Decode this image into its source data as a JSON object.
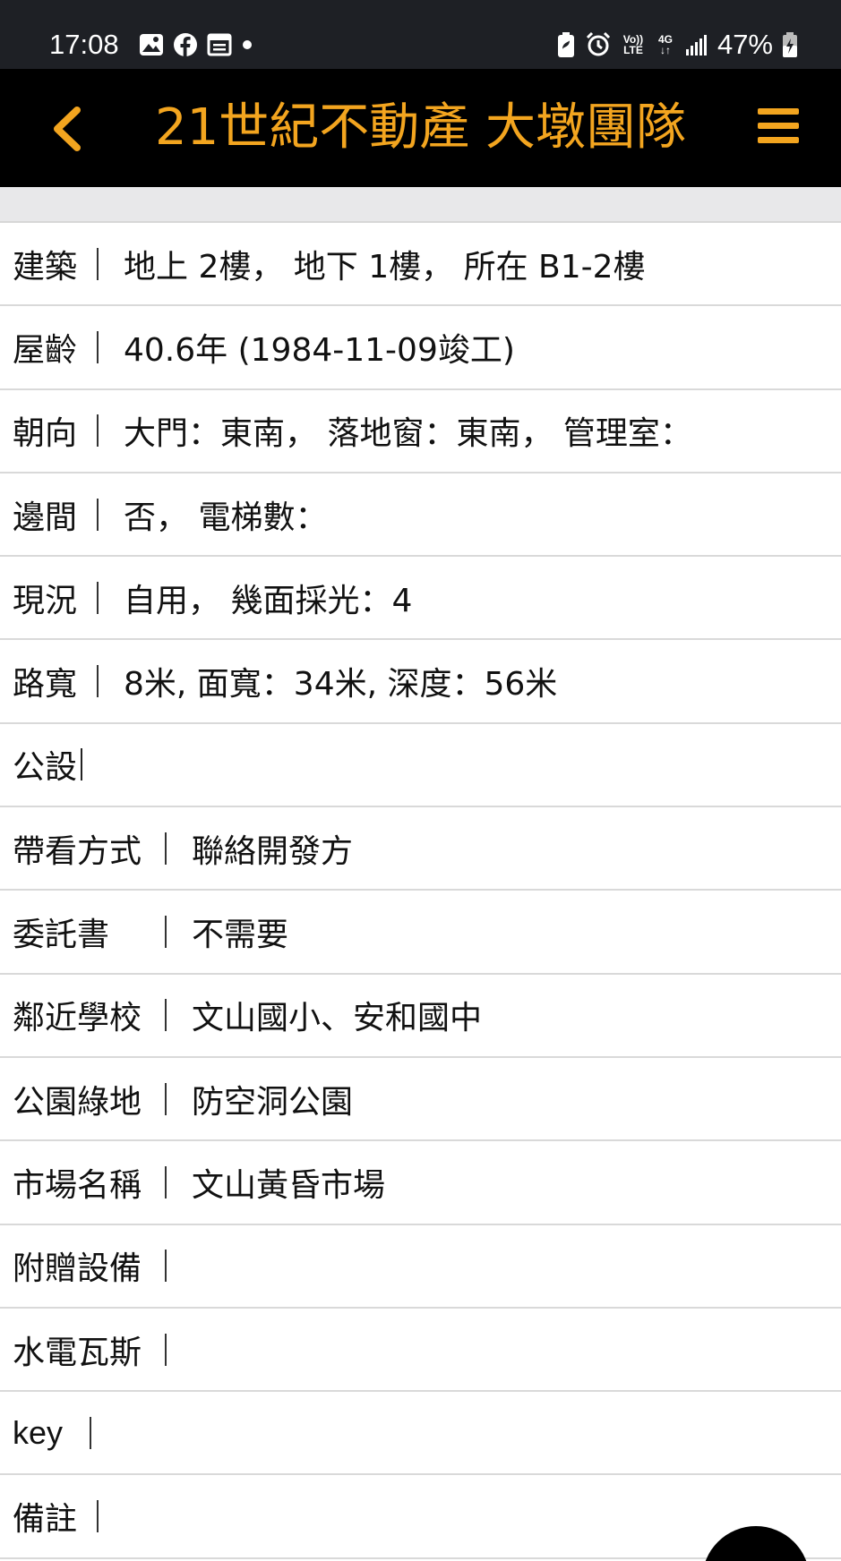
{
  "status_bar": {
    "time": "17:08",
    "battery": "47%",
    "network": "4G",
    "volte": "Vo)) LTE",
    "icons": [
      "gallery-icon",
      "facebook-icon",
      "calendar-icon",
      "notification-dot-icon",
      "battery-saver-icon",
      "alarm-icon",
      "volte-icon",
      "network-4g-icon",
      "signal-icon",
      "battery-icon"
    ]
  },
  "header": {
    "title": "21世紀不動產 大墩團隊",
    "accent_color": "#f3a51f",
    "back_icon": "chevron-left-icon",
    "menu_icon": "hamburger-menu-icon"
  },
  "rows": [
    {
      "label": "建築",
      "value": "地上 2樓， 地下 1樓， 所在 B1-2樓"
    },
    {
      "label": "屋齡",
      "value": "40.6年 (1984-11-09竣工)"
    },
    {
      "label": "朝向",
      "value": "大門：東南， 落地窗：東南， 管理室："
    },
    {
      "label": "邊間",
      "value": "否， 電梯數："
    },
    {
      "label": "現況",
      "value": "自用， 幾面採光：4"
    },
    {
      "label": "路寬",
      "value": "8米, 面寬：34米, 深度：56米"
    },
    {
      "label": "公設",
      "value": ""
    },
    {
      "label": "帶看方式",
      "value": "聯絡開發方"
    },
    {
      "label": "委託書",
      "value": "不需要"
    },
    {
      "label": "鄰近學校",
      "value": "文山國小、安和國中"
    },
    {
      "label": "公園綠地",
      "value": "防空洞公園"
    },
    {
      "label": "市場名稱",
      "value": "文山黃昏市場"
    },
    {
      "label": "附贈設備",
      "value": ""
    },
    {
      "label": "水電瓦斯",
      "value": ""
    },
    {
      "label": "key",
      "value": ""
    },
    {
      "label": "備註",
      "value": ""
    }
  ]
}
